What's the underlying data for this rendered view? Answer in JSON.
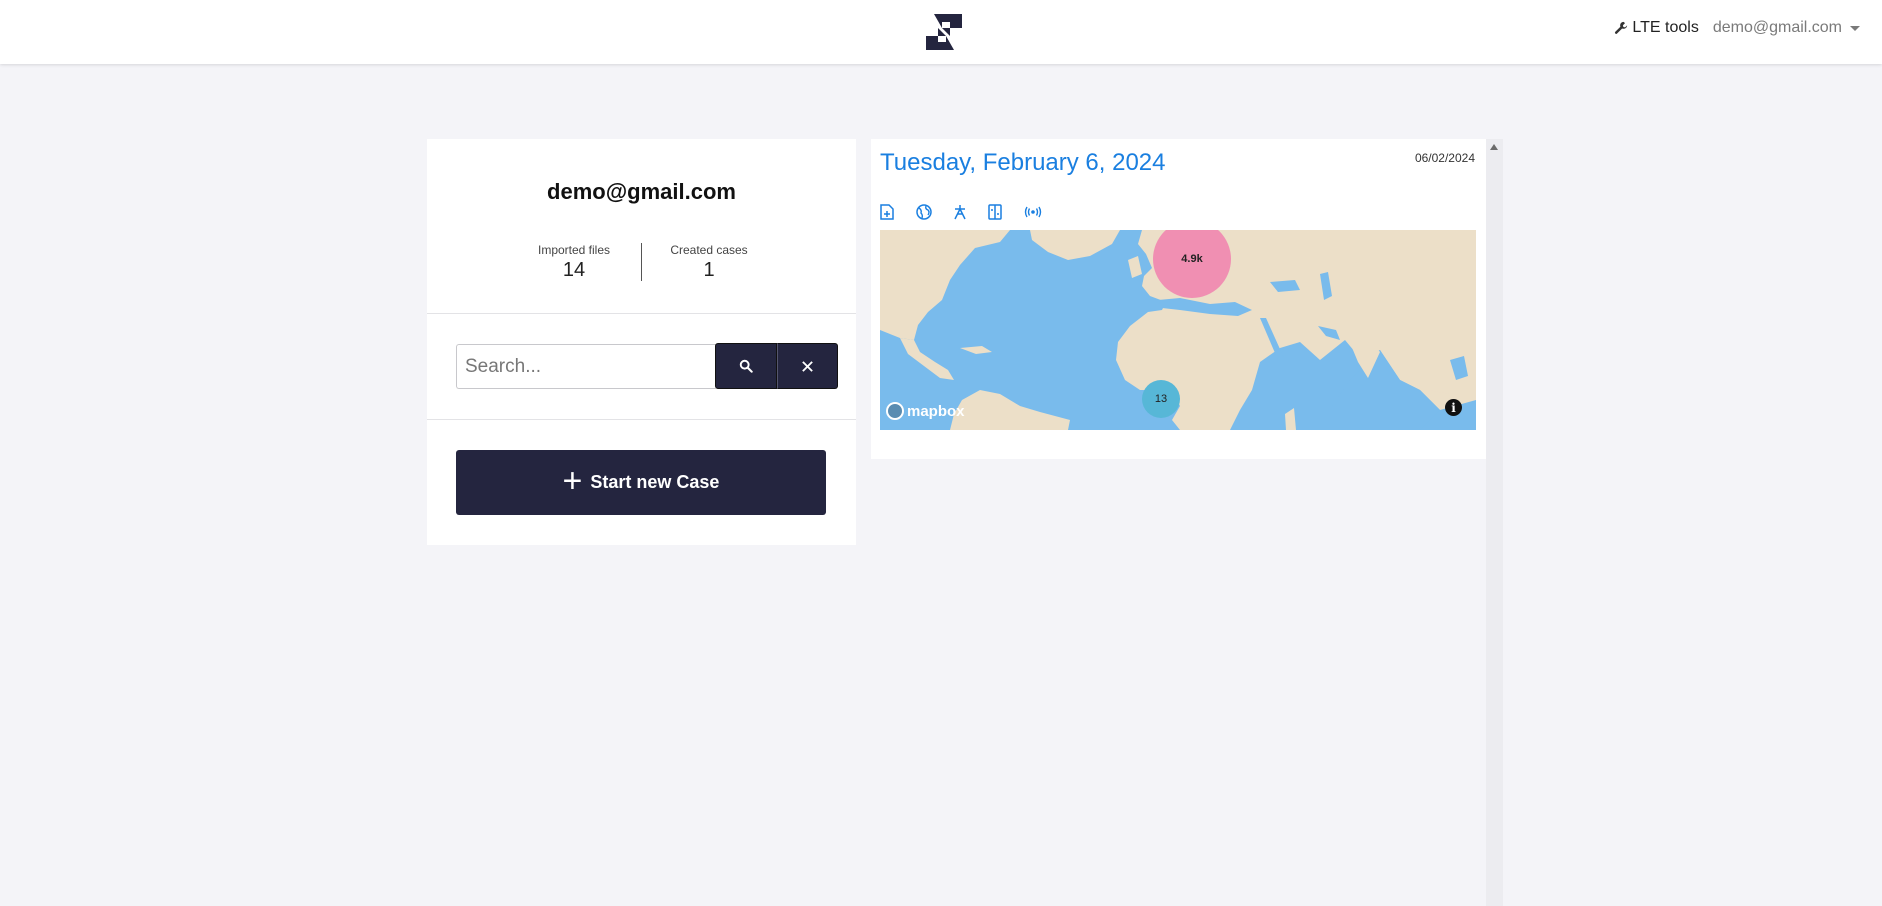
{
  "navbar": {
    "logo_icon": "s-logo-icon",
    "tools_label": "LTE tools",
    "tools_icon": "wrench-icon",
    "user_email": "demo@gmail.com"
  },
  "profile": {
    "email": "demo@gmail.com",
    "stats": [
      {
        "label": "Imported files",
        "value": "14"
      },
      {
        "label": "Created cases",
        "value": "1"
      }
    ],
    "search": {
      "placeholder": "Search...",
      "value": ""
    },
    "start_button_label": "Start new Case"
  },
  "date_card": {
    "title": "Tuesday, February 6, 2024",
    "short_date": "06/02/2024",
    "tool_icons": [
      "file-plus-icon",
      "globe-icon",
      "antenna-tower-icon",
      "sim-swap-icon",
      "broadcast-icon"
    ],
    "map": {
      "clusters": [
        {
          "label": "4.9k",
          "color": "#f08fb2"
        },
        {
          "label": "13",
          "color": "#57b7d7"
        }
      ],
      "attribution_logo": "mapbox",
      "info_label": "i",
      "colors": {
        "water": "#79bbec",
        "land": "#ecdfc8"
      }
    }
  },
  "colors": {
    "accent": "#1a7fe0",
    "primary_button": "#24253f",
    "background": "#f4f4f8"
  }
}
